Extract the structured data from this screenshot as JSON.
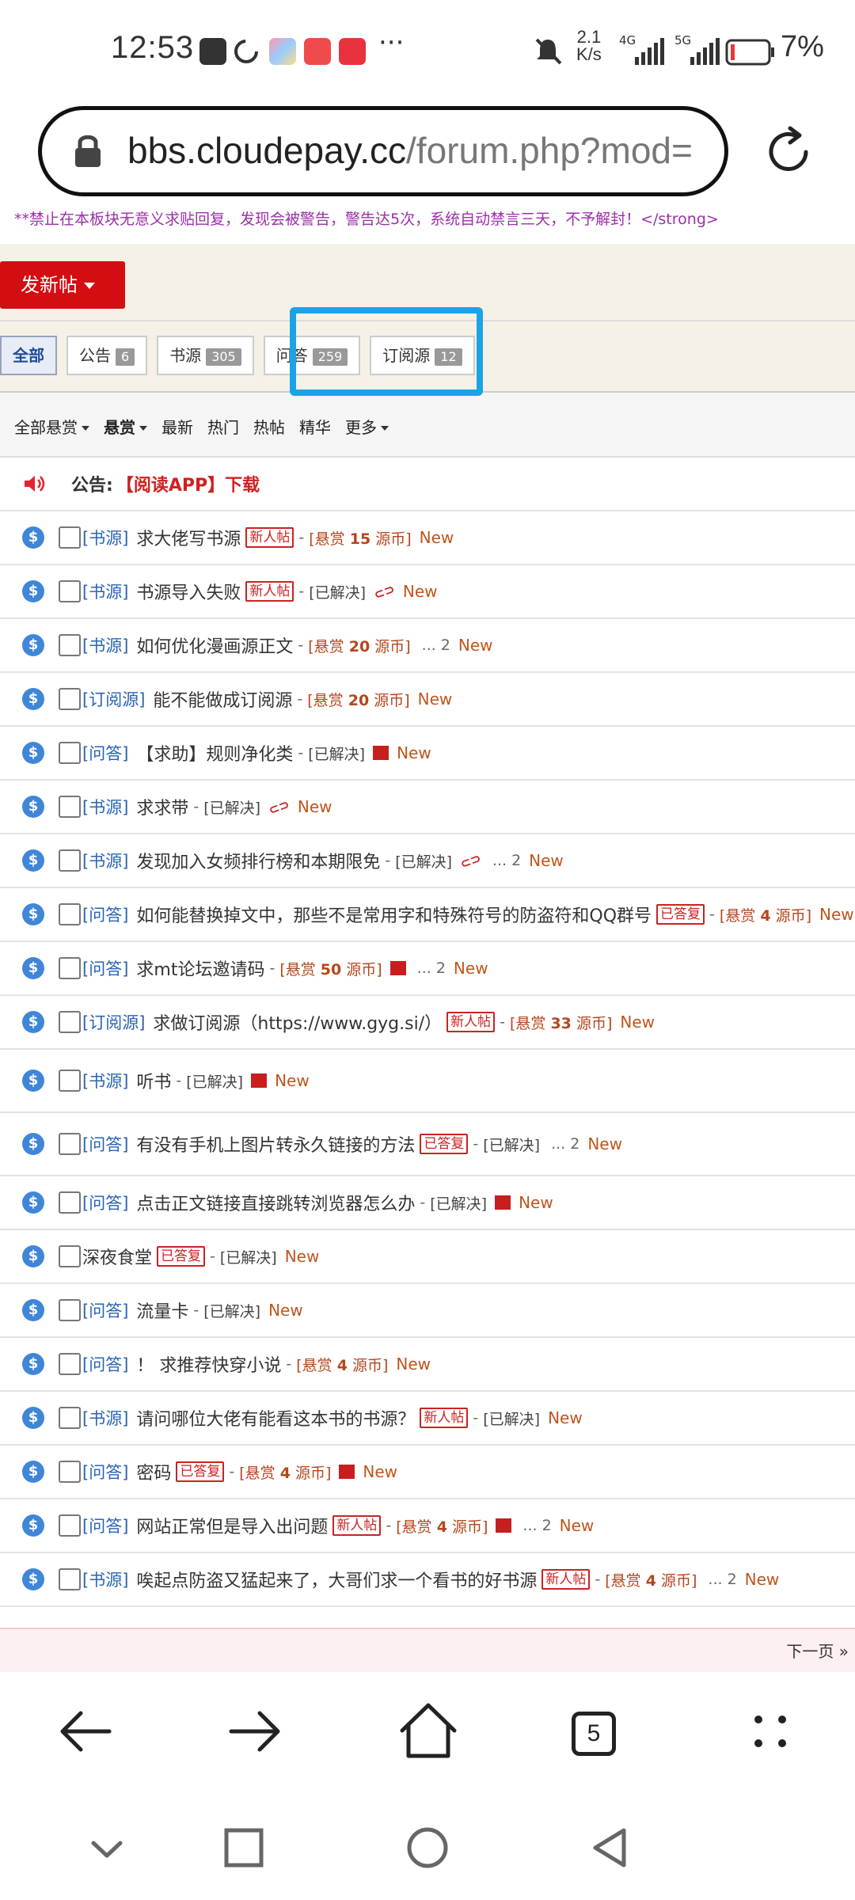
{
  "status_bar": {
    "time": "12:53",
    "net_speed_top": "2.1",
    "net_speed_unit": "K/s",
    "sig1": "4G",
    "sig2": "5G",
    "battery": "7%"
  },
  "browser": {
    "url_host": "bbs.cloudepay.cc",
    "url_path": "/forum.php?mod=",
    "tab_count": "5"
  },
  "forum": {
    "notice": "**禁止在本板块无意义求贴回复，发现会被警告，警告达5次，系统自动禁言三天，不予解封！</strong>",
    "new_post_label": "发新帖",
    "tabs": [
      {
        "label": "全部",
        "count": ""
      },
      {
        "label": "公告",
        "count": "6"
      },
      {
        "label": "书源",
        "count": "305"
      },
      {
        "label": "问答",
        "count": "259"
      },
      {
        "label": "订阅源",
        "count": "12"
      }
    ],
    "filters": [
      "全部悬赏",
      "悬赏",
      "最新",
      "热门",
      "热帖",
      "精华",
      "更多"
    ],
    "announcement": {
      "label": "公告:",
      "text": "【阅读APP】下载"
    },
    "sep": "-",
    "new_label": "New",
    "threads": [
      {
        "cat": "[书源]",
        "title": "求大佬写书源",
        "badge": "新人帖",
        "status": "[悬赏 15 源币]",
        "bounty": true
      },
      {
        "cat": "[书源]",
        "title": "书源导入失败",
        "badge": "新人帖",
        "status": "[已解决]",
        "clip": true
      },
      {
        "cat": "[书源]",
        "title": "如何优化漫画源正文",
        "status": "[悬赏 20 源币]",
        "bounty": true,
        "pages": "... 2"
      },
      {
        "cat": "[订阅源]",
        "title": "能不能做成订阅源",
        "status": "[悬赏 20 源币]",
        "bounty": true
      },
      {
        "cat": "[问答]",
        "title": "【求助】规则净化类",
        "status": "[已解决]",
        "img": true
      },
      {
        "cat": "[书源]",
        "title": "求求带",
        "status": "[已解决]",
        "clip": true
      },
      {
        "cat": "[书源]",
        "title": "发现加入女频排行榜和本期限免",
        "status": "[已解决]",
        "clip": true,
        "pages": "... 2"
      },
      {
        "cat": "[问答]",
        "title": "如何能替换掉文中，那些不是常用字和特殊符号的防盗符和QQ群号",
        "badge": "已答复",
        "status": "[悬赏 4 源币]",
        "bounty": true
      },
      {
        "cat": "[问答]",
        "title": "求mt论坛邀请码",
        "status": "[悬赏 50 源币]",
        "bounty": true,
        "img": true,
        "pages": "... 2"
      },
      {
        "cat": "[订阅源]",
        "title": "求做订阅源（https://www.gyg.si/）",
        "badge": "新人帖",
        "status": "[悬赏 33 源币]",
        "bounty": true
      },
      {
        "cat": "[书源]",
        "title": "听书",
        "status": "[已解决]",
        "img": true
      },
      {
        "cat": "[问答]",
        "title": "有没有手机上图片转永久链接的方法",
        "badge": "已答复",
        "status": "[已解决]",
        "pages": "... 2"
      },
      {
        "cat": "[问答]",
        "title": "点击正文链接直接跳转浏览器怎么办",
        "status": "[已解决]",
        "img": true
      },
      {
        "cat": "",
        "title": "深夜食堂",
        "badge": "已答复",
        "status": "[已解决]"
      },
      {
        "cat": "[问答]",
        "title": "流量卡",
        "status": "[已解决]"
      },
      {
        "cat": "[问答]",
        "title": "！ 求推荐快穿小说",
        "status": "[悬赏 4 源币]",
        "bounty": true
      },
      {
        "cat": "[书源]",
        "title": "请问哪位大佬有能看这本书的书源？",
        "badge": "新人帖",
        "status": "[已解决]"
      },
      {
        "cat": "[问答]",
        "title": "密码",
        "badge": "已答复",
        "status": "[悬赏 4 源币]",
        "bounty": true,
        "img": true
      },
      {
        "cat": "[问答]",
        "title": "网站正常但是导入出问题",
        "badge": "新人帖",
        "status": "[悬赏 4 源币]",
        "bounty": true,
        "img": true,
        "pages": "... 2"
      },
      {
        "cat": "[书源]",
        "title": "唉起点防盗又猛起来了，大哥们求一个看书的好书源",
        "badge": "新人帖",
        "status": "[悬赏 4 源币]",
        "bounty": true,
        "pages": "... 2"
      }
    ],
    "next_page": "下一页 »"
  },
  "colors": {
    "accent_red": "#d40d12",
    "highlight": "#1ba3e6",
    "link_blue": "#2a64b5"
  }
}
